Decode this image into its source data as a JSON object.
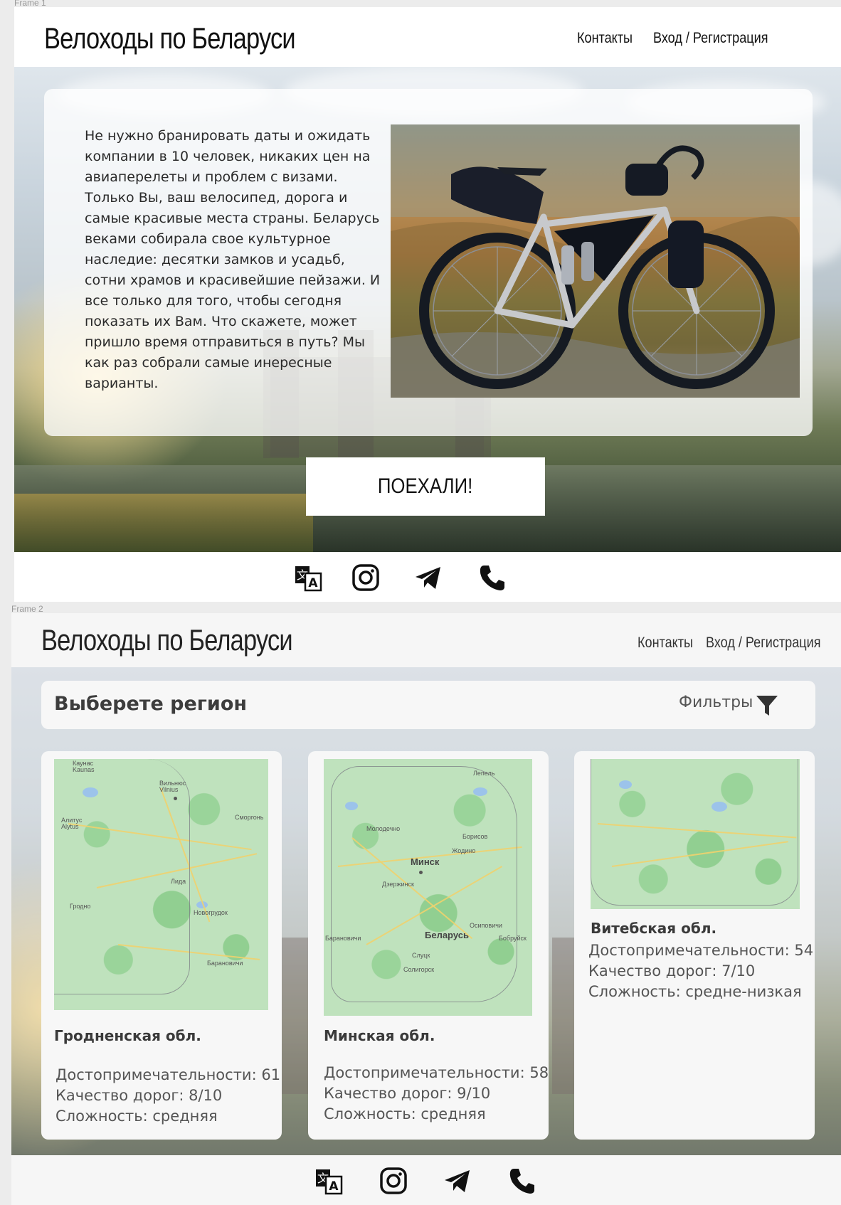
{
  "frame1": {
    "label": "Frame 1",
    "site_title": "Велоходы по Беларуси",
    "nav": {
      "contacts": "Контакты",
      "login": "Вход / Регистрация"
    },
    "intro_text": "Не нужно бранировать даты и ожидать компании в 10 человек, никаких цен на авиаперелеты и проблем с визами. Только Вы, ваш велосипед, дорога и самые красивые места страны. Беларусь веками собирала свое культурное наследие: десятки замков и усадьб, сотни храмов и красивейшие пейзажи. И все только для того, чтобы сегодня показать их Вам. Что скажете, может пришло время отправиться в путь? Мы как раз собрали самые инересные варианты.",
    "cta_label": "ПОЕХАЛИ!"
  },
  "frame2": {
    "label": "Frame 2",
    "site_title": "Велоходы по Беларуси",
    "nav": {
      "contacts": "Контакты",
      "login": "Вход / Регистрация"
    },
    "region_title": "Выберете регион",
    "filters_label": "Фильтры",
    "regions": [
      {
        "name": "Гродненская обл.",
        "attractions": "Достопримечательности: 61",
        "roads": "Качество дорог: 8/10",
        "difficulty": "Сложность: средняя",
        "map_labels": {
          "a": "Каунас\nKaunas",
          "b": "Вильнюс\nVilnius",
          "c": "Алитус\nAlytus",
          "d": "Гродно",
          "e": "Лида",
          "f": "Новогрудок",
          "g": "Барановичи",
          "h": "Сморгонь"
        }
      },
      {
        "name": "Минская обл.",
        "attractions": "Достопримечательности: 58",
        "roads": "Качество дорог: 9/10",
        "difficulty": "Сложность: средняя",
        "map_labels": {
          "a": "Минск",
          "b": "Беларусь",
          "c": "Молодечно",
          "d": "Борисов",
          "e": "Жодино",
          "f": "Дзержинск",
          "g": "Слуцк",
          "h": "Солигорск",
          "i": "Бобруйск",
          "j": "Барановичи",
          "k": "Лепель",
          "l": "Осиповичи"
        }
      },
      {
        "name": "Витебская обл.",
        "attractions": "Достопримечательности: 54",
        "roads": "Качество дорог: 7/10",
        "difficulty": "Сложность: средне-низкая",
        "map_labels": {}
      }
    ]
  },
  "footer_icons": [
    "translate-icon",
    "instagram-icon",
    "telegram-icon",
    "phone-icon"
  ],
  "colors": {
    "accent_dark": "#111111",
    "card_bg": "#f7f7f7",
    "map_green": "#bfe2bd"
  }
}
